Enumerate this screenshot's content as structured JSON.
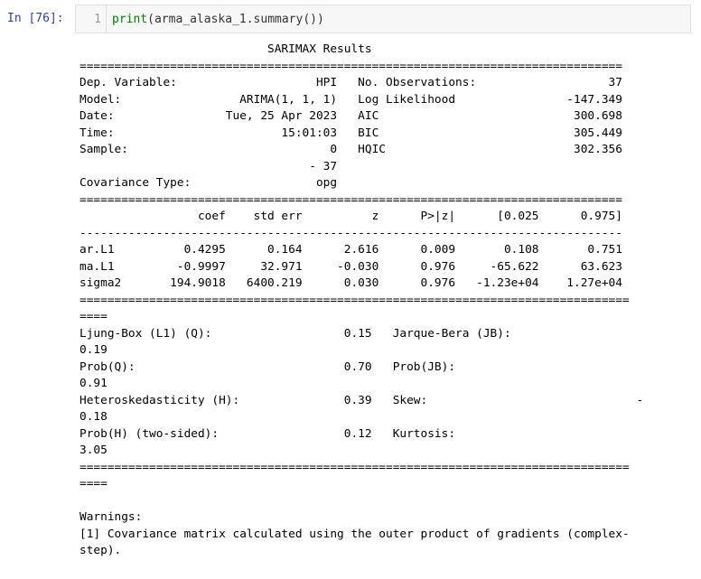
{
  "cell": {
    "prompt": "In [76]:",
    "line_number": "1",
    "code_fn": "print",
    "code_rest": "(arma_alaska_1.summary())"
  },
  "output": {
    "text": "                           SARIMAX Results                                \n==============================================================================\nDep. Variable:                    HPI   No. Observations:                   37\nModel:                 ARIMA(1, 1, 1)   Log Likelihood                -147.349\nDate:                Tue, 25 Apr 2023   AIC                            300.698\nTime:                        15:01:03   BIC                            305.449\nSample:                             0   HQIC                           302.356\n                                 - 37                                         \nCovariance Type:                  opg                                         \n==============================================================================\n                 coef    std err          z      P>|z|      [0.025      0.975]\n------------------------------------------------------------------------------\nar.L1          0.4295      0.164      2.616      0.009       0.108       0.751\nma.L1         -0.9997     32.971     -0.030      0.976     -65.622      63.623\nsigma2       194.9018   6400.219      0.030      0.976   -1.23e+04    1.27e+04\n===============================================================================\n====\nLjung-Box (L1) (Q):                   0.15   Jarque-Bera (JB):                   \n0.19\nProb(Q):                              0.70   Prob(JB):                           \n0.91\nHeteroskedasticity (H):               0.39   Skew:                              -\n0.18\nProb(H) (two-sided):                  0.12   Kurtosis:                           \n3.05\n===============================================================================\n====\n\nWarnings:\n[1] Covariance matrix calculated using the outer product of gradients (complex-\nstep)."
  }
}
